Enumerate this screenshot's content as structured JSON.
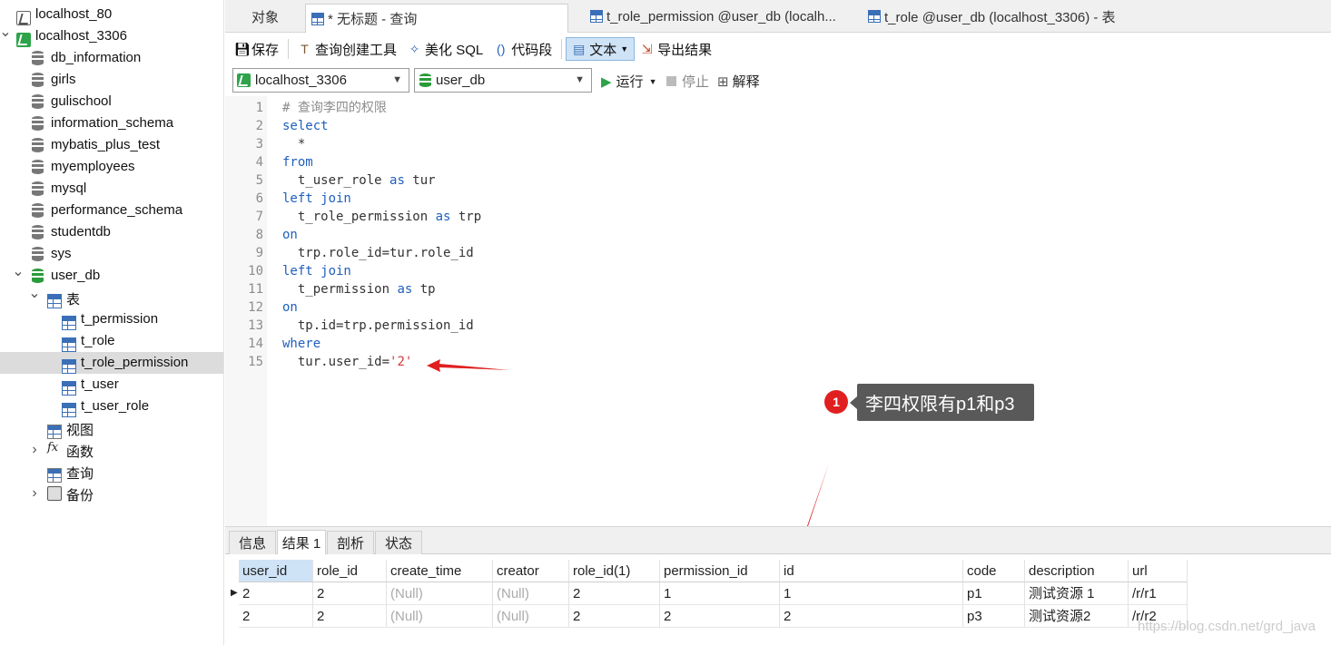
{
  "sidebar": {
    "items": [
      {
        "label": "localhost_80"
      },
      {
        "label": "localhost_3306"
      },
      {
        "label": "db_information"
      },
      {
        "label": "girls"
      },
      {
        "label": "gulischool"
      },
      {
        "label": "information_schema"
      },
      {
        "label": "mybatis_plus_test"
      },
      {
        "label": "myemployees"
      },
      {
        "label": "mysql"
      },
      {
        "label": "performance_schema"
      },
      {
        "label": "studentdb"
      },
      {
        "label": "sys"
      },
      {
        "label": "user_db"
      },
      {
        "label": "表"
      },
      {
        "label": "t_permission"
      },
      {
        "label": "t_role"
      },
      {
        "label": "t_role_permission"
      },
      {
        "label": "t_user"
      },
      {
        "label": "t_user_role"
      },
      {
        "label": "视图"
      },
      {
        "label": "函数"
      },
      {
        "label": "查询"
      },
      {
        "label": "备份"
      }
    ]
  },
  "tabs": [
    {
      "label": "对象"
    },
    {
      "label": "* 无标题 - 查询"
    },
    {
      "label": "t_role_permission @user_db (localh..."
    },
    {
      "label": "t_role @user_db (localhost_3306) - 表"
    }
  ],
  "toolbar": {
    "save": "保存",
    "query_builder": "查询创建工具",
    "beautify": "美化 SQL",
    "snippet": "代码段",
    "text": "文本",
    "export": "导出结果"
  },
  "selectors": {
    "connection": "localhost_3306",
    "database": "user_db",
    "run": "运行",
    "stop": "停止",
    "explain": "解释"
  },
  "editor": {
    "line_numbers": [
      "1",
      "2",
      "3",
      "4",
      "5",
      "6",
      "7",
      "8",
      "9",
      "10",
      "11",
      "12",
      "13",
      "14",
      "15"
    ],
    "lines": [
      [
        {
          "t": "# 查询李四的权限",
          "c": "cm"
        }
      ],
      [
        {
          "t": "select",
          "c": "kw"
        }
      ],
      [
        {
          "t": "  *",
          "c": ""
        }
      ],
      [
        {
          "t": "from",
          "c": "kw"
        }
      ],
      [
        {
          "t": "  t_user_role ",
          "c": ""
        },
        {
          "t": "as",
          "c": "kw"
        },
        {
          "t": " tur",
          "c": ""
        }
      ],
      [
        {
          "t": "left join",
          "c": "kw"
        }
      ],
      [
        {
          "t": "  t_role_permission ",
          "c": ""
        },
        {
          "t": "as",
          "c": "kw"
        },
        {
          "t": " trp",
          "c": ""
        }
      ],
      [
        {
          "t": "on",
          "c": "kw"
        }
      ],
      [
        {
          "t": "  trp.role_id=tur.role_id",
          "c": ""
        }
      ],
      [
        {
          "t": "left join",
          "c": "kw"
        }
      ],
      [
        {
          "t": "  t_permission ",
          "c": ""
        },
        {
          "t": "as",
          "c": "kw"
        },
        {
          "t": " tp",
          "c": ""
        }
      ],
      [
        {
          "t": "on",
          "c": "kw"
        }
      ],
      [
        {
          "t": "  tp.id=trp.permission_id",
          "c": ""
        }
      ],
      [
        {
          "t": "where",
          "c": "kw"
        }
      ],
      [
        {
          "t": "  tur.user_id=",
          "c": ""
        },
        {
          "t": "'2'",
          "c": "str"
        }
      ]
    ]
  },
  "annotation": {
    "badge": "1",
    "callout": "李四权限有p1和p3",
    "arrow_color": "#e02020"
  },
  "result_tabs": [
    {
      "label": "信息"
    },
    {
      "label": "结果 1"
    },
    {
      "label": "剖析"
    },
    {
      "label": "状态"
    }
  ],
  "grid": {
    "columns": [
      "user_id",
      "role_id",
      "create_time",
      "creator",
      "role_id(1)",
      "permission_id",
      "id",
      "code",
      "description",
      "url"
    ],
    "rows": [
      [
        "2",
        "2",
        "(Null)",
        "(Null)",
        "2",
        "1",
        "1",
        "p1",
        "测试资源 1",
        "/r/r1"
      ],
      [
        "2",
        "2",
        "(Null)",
        "(Null)",
        "2",
        "2",
        "2",
        "p3",
        "测试资源2",
        "/r/r2"
      ]
    ]
  },
  "watermark": "https://blog.csdn.net/grd_java",
  "colors": {
    "accent": "#1f5fbf",
    "selected_row": "#dcdcdc",
    "header_highlight": "#cfe3f7",
    "string": "#d33a3a"
  }
}
